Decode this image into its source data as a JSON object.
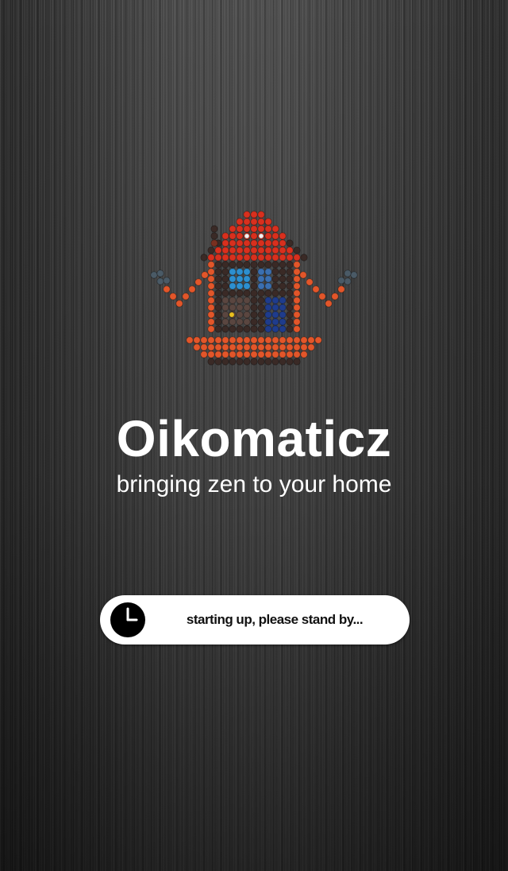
{
  "app": {
    "title": "Oikomaticz",
    "tagline": "bringing zen to your home"
  },
  "status": {
    "icon": "clock-icon",
    "message": "starting up, please stand by..."
  },
  "colors": {
    "background": "#3a3a3a",
    "text": "#ffffff",
    "pill": "#ffffff",
    "pill_text": "#111111",
    "mascot_roof": "#d8301e",
    "mascot_body": "#e2562a",
    "mascot_window": "#2d8fd0",
    "mascot_door": "#1f3c8c"
  }
}
